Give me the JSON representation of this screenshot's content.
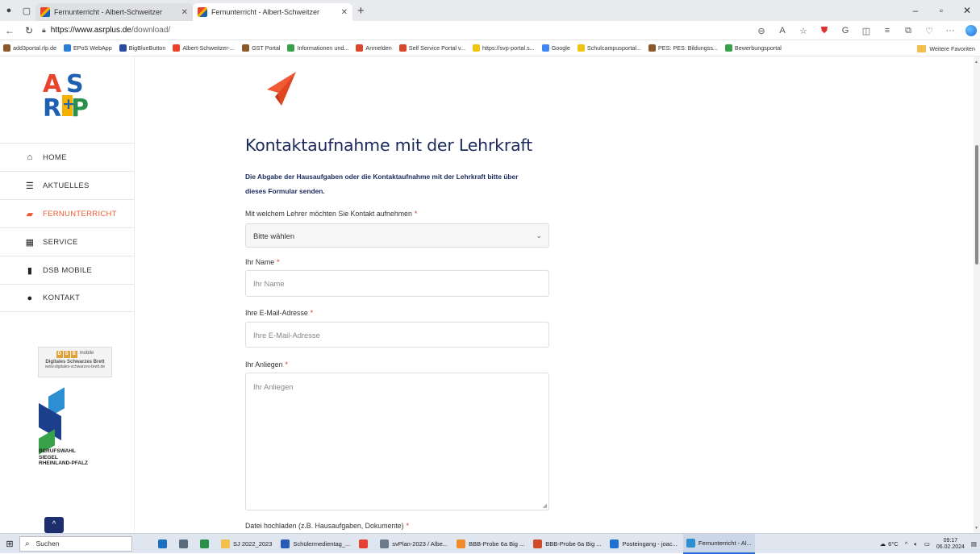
{
  "browser": {
    "tabs": [
      {
        "title": "Fernunterricht - Albert-Schweitzer",
        "active": false
      },
      {
        "title": "Fernunterricht - Albert-Schweitzer",
        "active": true
      }
    ],
    "new_tab": "+",
    "url_domain": "https://www.asrplus.de",
    "url_path": "/download/",
    "bookmarks": [
      {
        "label": "add3portal.rlp.de",
        "color": "#8a5a2b"
      },
      {
        "label": "EPoS WebApp",
        "color": "#2a7fd4"
      },
      {
        "label": "BigBlueButton",
        "color": "#2b4c9e"
      },
      {
        "label": "Albert-Schweitzer-...",
        "color": "#e9432b"
      },
      {
        "label": "GST Portal",
        "color": "#8a5a2b"
      },
      {
        "label": "Informationen und...",
        "color": "#3aa04a"
      },
      {
        "label": "Anmelden",
        "color": "#d9472b"
      },
      {
        "label": "Self Service Portal v...",
        "color": "#d9472b"
      },
      {
        "label": "https://svp-portal.s...",
        "color": "#f1c40f"
      },
      {
        "label": "Google",
        "color": "#4285f4"
      },
      {
        "label": "Schulcampusportal...",
        "color": "#f1c40f"
      },
      {
        "label": "PES: PES: Bildungss...",
        "color": "#8a5a2b"
      },
      {
        "label": "Bewerbungsportal",
        "color": "#3aa04a"
      }
    ],
    "bookmarks_folder": "Weitere Favoriten"
  },
  "sidebar": {
    "logo_text": "ASR+P",
    "menu": [
      {
        "label": "HOME",
        "icon": "home-icon",
        "glyph": "⌂",
        "active": false
      },
      {
        "label": "AKTUELLES",
        "icon": "list-icon",
        "glyph": "☰",
        "active": false
      },
      {
        "label": "FERNUNTERRICHT",
        "icon": "folder-open-icon",
        "glyph": "▰",
        "active": true
      },
      {
        "label": "SERVICE",
        "icon": "calendar-icon",
        "glyph": "▦",
        "active": false
      },
      {
        "label": "DSB MOBILE",
        "icon": "file-icon",
        "glyph": "▮",
        "active": false
      },
      {
        "label": "KONTAKT",
        "icon": "chat-bubble-icon",
        "glyph": "●",
        "active": false
      }
    ],
    "dsb_banner": {
      "letters": [
        "D",
        "S",
        "B"
      ],
      "sub": "mobile",
      "caption": "Digitales Schwarzes Brett",
      "url": "www.digitales-schwarzes-brett.de"
    },
    "siegel_lines": [
      "BERUFSWAHL",
      "SIEGEL",
      "RHEINLAND-PFALZ"
    ],
    "scroll_top_glyph": "^"
  },
  "form": {
    "title": "Kontaktaufnahme mit der Lehrkraft",
    "intro_line1": "Die Abgabe der Hausaufgaben oder die Kontaktaufnahme mit der Lehrkraft bitte über",
    "intro_line2": "dieses Formular senden.",
    "teacher_label": "Mit welchem Lehrer möchten Sie Kontakt aufnehmen",
    "teacher_value": "Bitte wählen",
    "name_label": "Ihr Name",
    "name_placeholder": "Ihr Name",
    "email_label": "Ihre E-Mail-Adresse",
    "email_placeholder": "Ihre E-Mail-Adresse",
    "message_label": "Ihr Anliegen",
    "message_placeholder": "Ihr Anliegen",
    "upload_label": "Datei hochladen (z.B. Hausaufgaben, Dokumente)",
    "required_mark": "*"
  },
  "taskbar": {
    "search_label": "Suchen",
    "items": [
      {
        "label": "",
        "color": "#1d6fbf"
      },
      {
        "label": "",
        "color": "#5a6b7d"
      },
      {
        "label": "",
        "color": "#2a8f4a"
      },
      {
        "label": "SJ 2022_2023",
        "color": "#f3c04b"
      },
      {
        "label": "Schülermedientag_...",
        "color": "#2b5cb3"
      },
      {
        "label": "",
        "color": "#e34133"
      },
      {
        "label": "svPlan-2023 / Albe...",
        "color": "#6b7b8c"
      },
      {
        "label": "BBB-Probe 6a Big ...",
        "color": "#f08b2a"
      },
      {
        "label": "BBB-Probe 6a Big ...",
        "color": "#d04a2a"
      },
      {
        "label": "Posteingang - joac...",
        "color": "#1f6fcf"
      },
      {
        "label": "Fernunterricht - Al...",
        "color": "#2b8fd1"
      }
    ],
    "weather": "6°C",
    "time": "09:17",
    "date": "06.02.2024"
  }
}
